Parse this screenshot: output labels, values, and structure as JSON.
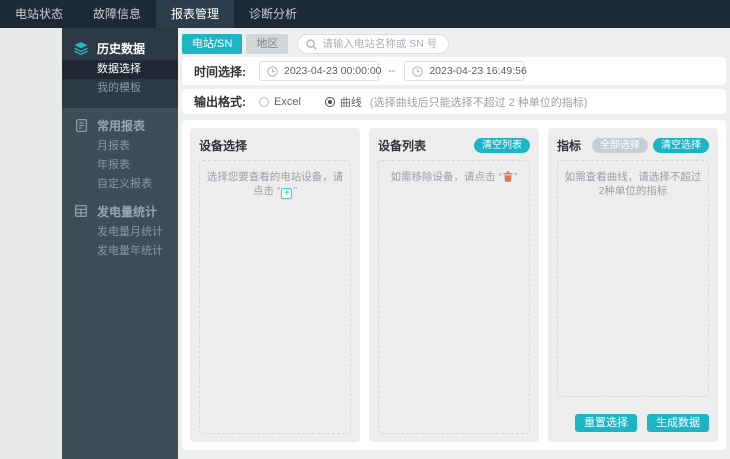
{
  "navbar": {
    "items": [
      {
        "label": "电站状态",
        "active": false
      },
      {
        "label": "故障信息",
        "active": false
      },
      {
        "label": "报表管理",
        "active": true
      },
      {
        "label": "诊断分析",
        "active": false
      }
    ]
  },
  "sidebar": {
    "groups": [
      {
        "title": "历史数据",
        "icon": "layers-icon",
        "items": [
          {
            "label": "数据选择",
            "active": true
          },
          {
            "label": "我的模板",
            "active": false
          }
        ]
      },
      {
        "title": "常用报表",
        "icon": "document-icon",
        "items": [
          {
            "label": "月报表"
          },
          {
            "label": "年报表"
          },
          {
            "label": "自定义报表"
          }
        ]
      },
      {
        "title": "发电量统计",
        "icon": "table-icon",
        "items": [
          {
            "label": "发电量月统计"
          },
          {
            "label": "发电量年统计"
          }
        ]
      }
    ]
  },
  "filters": {
    "station_tab": "电站/SN",
    "region_tab": "地区",
    "search_placeholder": "请输入电站名称或 SN 号",
    "time_label": "时间选择:",
    "time_start": "2023-04-23 00:00:00",
    "time_separator": "--",
    "time_end": "2023-04-23 16:49:56",
    "format_label": "输出格式:",
    "format_excel": "Excel",
    "format_curve": "曲线",
    "format_curve_note": "(选择曲线后只能选择不超过 2 种单位的指标)"
  },
  "panels": {
    "device_select": {
      "title": "设备选择",
      "placeholder_prefix": "选择您要查看的电站设备，请点击 “",
      "placeholder_suffix": "”"
    },
    "device_list": {
      "title": "设备列表",
      "clear_button": "清空列表",
      "placeholder_prefix": "如需移除设备，请点击 “",
      "placeholder_suffix": "”"
    },
    "indicators": {
      "title": "指标",
      "select_all_button": "全部选择",
      "clear_button": "清空选择",
      "placeholder": "如需查看曲线，请选择不超过2种单位的指标"
    }
  },
  "actions": {
    "reset_button": "重置选择",
    "generate_button": "生成数据"
  },
  "icons": {
    "plus_glyph": "+"
  },
  "colors": {
    "accent": "#1db5c5",
    "navbar_bg": "#1d2935",
    "sidebar_bg": "#3e4d58",
    "trash_icon": "#e2734b"
  }
}
